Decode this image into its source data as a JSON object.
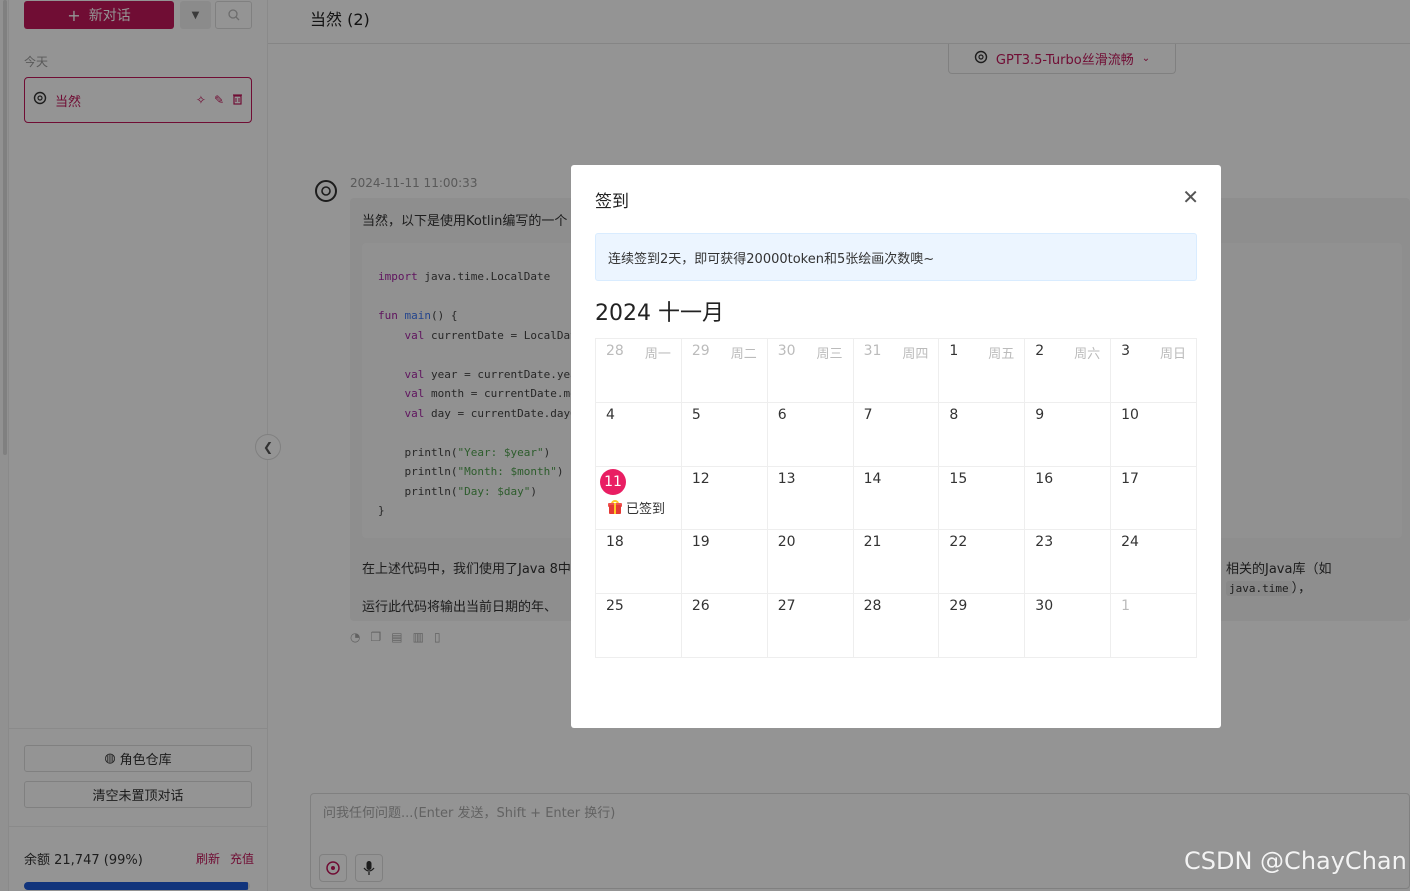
{
  "sidebar": {
    "new_chat_label": "新对话",
    "group_today": "今天",
    "conversations": [
      {
        "title": "当然"
      }
    ],
    "role_repo_label": "角色仓库",
    "clear_label": "清空未置顶对话",
    "balance_text": "余额 21,747 (99%)",
    "refresh_label": "刷新",
    "recharge_label": "充值",
    "balance_percent": 99
  },
  "header": {
    "title": "当然",
    "count": "(2)",
    "model": "GPT3.5-Turbo丝滑流畅"
  },
  "message": {
    "timestamp": "2024-11-11 11:00:33",
    "intro": "当然，以下是使用Kotlin编写的一个",
    "para1_start": "在上述代码中，我们使用了Java 8中",
    "para1_end_a": "相关的Java库（如",
    "para1_code": "java.time",
    "para1_end_b": "），",
    "para2": "运行此代码将输出当前日期的年、"
  },
  "input": {
    "placeholder": "问我任何问题...(Enter 发送，Shift + Enter 换行)"
  },
  "watermark": "CSDN @ChayChan",
  "modal": {
    "title": "签到",
    "notice": "连续签到2天，即可获得20000token和5张绘画次数噢~",
    "calendar_title": "2024 十一月",
    "signed_label": "已签到",
    "weekdays": [
      "周一",
      "周二",
      "周三",
      "周四",
      "周五",
      "周六",
      "周日"
    ],
    "weeks": [
      [
        {
          "d": "28",
          "other": true
        },
        {
          "d": "29",
          "other": true
        },
        {
          "d": "30",
          "other": true
        },
        {
          "d": "31",
          "other": true
        },
        {
          "d": "1"
        },
        {
          "d": "2"
        },
        {
          "d": "3"
        }
      ],
      [
        {
          "d": "4"
        },
        {
          "d": "5"
        },
        {
          "d": "6"
        },
        {
          "d": "7"
        },
        {
          "d": "8"
        },
        {
          "d": "9"
        },
        {
          "d": "10"
        }
      ],
      [
        {
          "d": "11",
          "today": true,
          "signed": true
        },
        {
          "d": "12"
        },
        {
          "d": "13"
        },
        {
          "d": "14"
        },
        {
          "d": "15"
        },
        {
          "d": "16"
        },
        {
          "d": "17"
        }
      ],
      [
        {
          "d": "18"
        },
        {
          "d": "19"
        },
        {
          "d": "20"
        },
        {
          "d": "21"
        },
        {
          "d": "22"
        },
        {
          "d": "23"
        },
        {
          "d": "24"
        }
      ],
      [
        {
          "d": "25"
        },
        {
          "d": "26"
        },
        {
          "d": "27"
        },
        {
          "d": "28"
        },
        {
          "d": "29"
        },
        {
          "d": "30"
        },
        {
          "d": "1",
          "other": true
        }
      ]
    ]
  }
}
